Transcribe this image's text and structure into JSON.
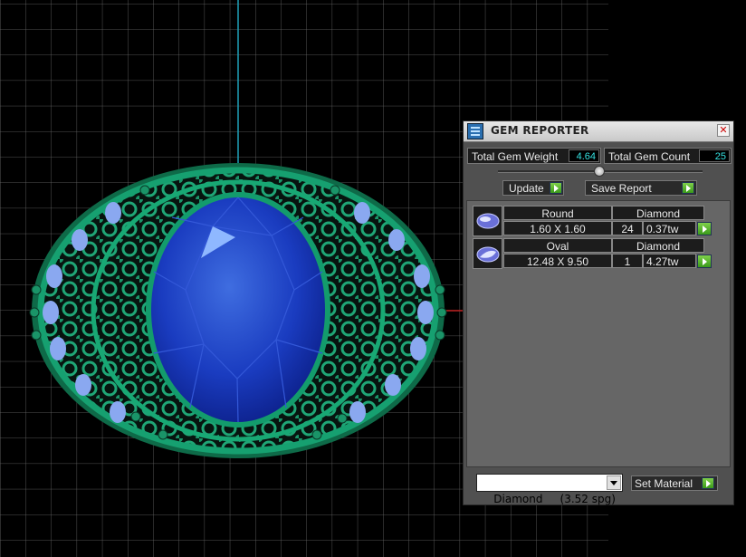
{
  "viewport": {
    "grid_color": "#6a6a6a",
    "axis_y_color": "#1fa0b8",
    "axis_x_color": "#c02020",
    "ring_color": "#138a5e",
    "gem_color": "#1a3cc0",
    "side_gem_color": "#8aa8f0"
  },
  "panel": {
    "title": "GEM REPORTER",
    "close_icon": "close-icon",
    "total_weight_label": "Total Gem Weight",
    "total_weight_value": "4.64",
    "total_count_label": "Total Gem Count",
    "total_count_value": "25",
    "update_label": "Update",
    "save_report_label": "Save Report",
    "gems": [
      {
        "shape": "Round",
        "size": "1.60 X 1.60",
        "count": "24",
        "material": "Diamond",
        "weight": "0.37tw",
        "icon": "round-gem-icon"
      },
      {
        "shape": "Oval",
        "size": "12.48 X 9.50",
        "count": "1",
        "material": "Diamond",
        "weight": "4.27tw",
        "icon": "oval-gem-icon"
      }
    ],
    "material_select": "Diamond     (3.52 spg)",
    "set_material_label": "Set Material"
  }
}
